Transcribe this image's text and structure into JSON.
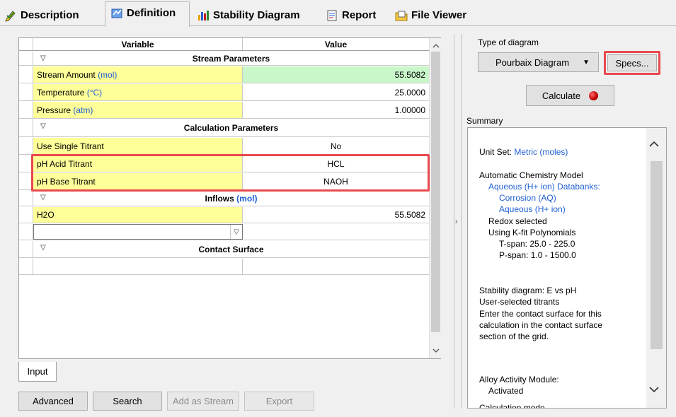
{
  "tabs": [
    {
      "label": "Description",
      "icon": "pencil-check-icon"
    },
    {
      "label": "Definition",
      "icon": "definition-icon"
    },
    {
      "label": "Stability Diagram",
      "icon": "bar-chart-icon"
    },
    {
      "label": "Report",
      "icon": "report-icon"
    },
    {
      "label": "File Viewer",
      "icon": "folder-icon"
    }
  ],
  "grid": {
    "header": {
      "variable": "Variable",
      "value": "Value"
    },
    "stream_section": "Stream Parameters",
    "stream_amount": {
      "label": "Stream Amount",
      "unit": "(mol)",
      "value": "55.5082"
    },
    "temperature": {
      "label": "Temperature",
      "unit": "(°C)",
      "value": "25.0000"
    },
    "pressure": {
      "label": "Pressure",
      "unit": "(atm)",
      "value": "1.00000"
    },
    "calc_section": "Calculation Parameters",
    "single_titrant": {
      "label": "Use Single Titrant",
      "value": "No"
    },
    "acid_titrant": {
      "label": "pH Acid Titrant",
      "value": "HCL"
    },
    "base_titrant": {
      "label": "pH Base Titrant",
      "value": "NAOH"
    },
    "inflows_section": "Inflows",
    "inflows_unit": "(mol)",
    "h2o": {
      "label": "H2O",
      "value": "55.5082"
    },
    "contact_section": "Contact Surface"
  },
  "bottom": {
    "input_tab": "Input",
    "advanced": "Advanced",
    "search": "Search",
    "add_stream": "Add as Stream",
    "export": "Export"
  },
  "right": {
    "type_label": "Type of diagram",
    "diagram_type": "Pourbaix Diagram",
    "specs": "Specs...",
    "calculate": "Calculate",
    "summary_label": "Summary"
  },
  "summary": {
    "unit_set_label": "Unit Set: ",
    "unit_set_value": "Metric (moles)",
    "model": "Automatic Chemistry Model",
    "databanks": "Aqueous (H+ ion) Databanks:",
    "db1": "Corrosion (AQ)",
    "db2": "Aqueous (H+ ion)",
    "redox": "Redox selected",
    "kfit": "Using K-fit Polynomials",
    "tspan": "T-span: 25.0 - 225.0",
    "pspan": "P-span: 1.0 - 1500.0",
    "stability": "Stability diagram: E vs pH",
    "titrants": "User-selected titrants",
    "contact1": "Enter the contact surface for this",
    "contact2": "calculation in the contact surface",
    "contact3": "section of the grid.",
    "alloy": "Alloy Activity Module:",
    "activated": "Activated",
    "cut": "Calculation mode"
  },
  "colors": {
    "highlight": "#e8494f",
    "yellow_cell": "#ffff99",
    "green_cell": "#c9f7c9",
    "link_blue": "#1f5fd4"
  }
}
